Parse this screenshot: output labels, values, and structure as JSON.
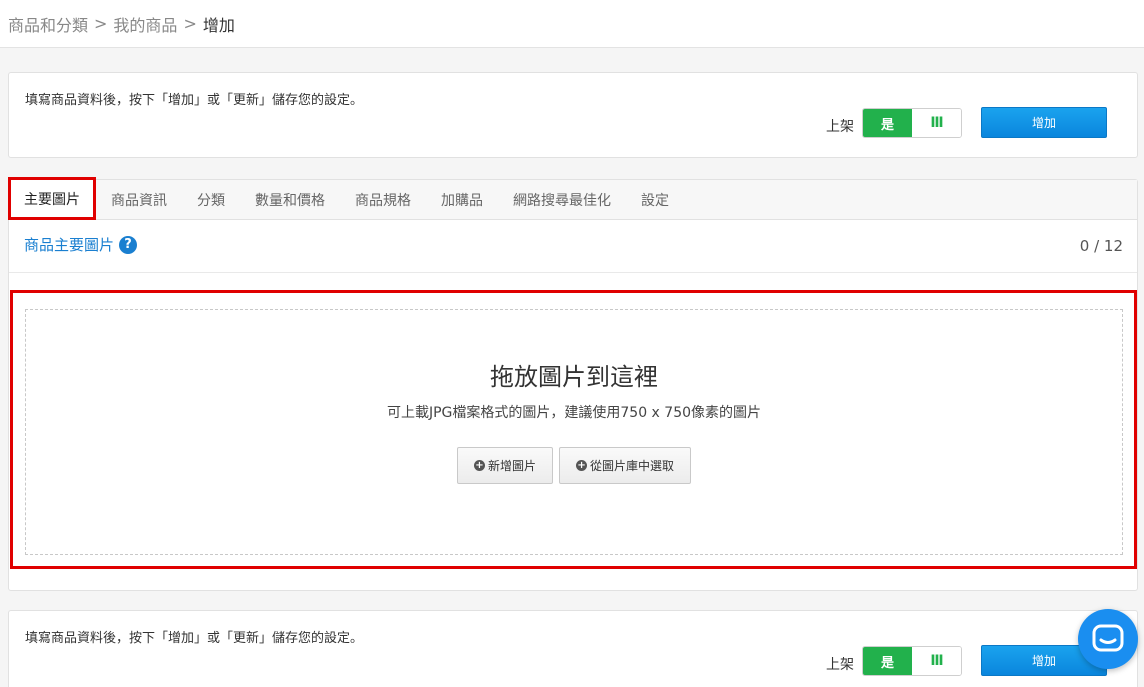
{
  "breadcrumb": {
    "items": [
      "商品和分類",
      "我的商品"
    ],
    "separator": ">",
    "current": "增加"
  },
  "save_bar": {
    "hint": "填寫商品資料後，按下「增加」或「更新」儲存您的設定。",
    "listed_label": "上架",
    "toggle_on": "是",
    "toggle_off": "Ⅲ",
    "add_button": "增加"
  },
  "tabs": [
    {
      "label": "主要圖片",
      "active": true
    },
    {
      "label": "商品資訊"
    },
    {
      "label": "分類"
    },
    {
      "label": "數量和價格"
    },
    {
      "label": "商品規格"
    },
    {
      "label": "加購品"
    },
    {
      "label": "網路搜尋最佳化"
    },
    {
      "label": "設定"
    }
  ],
  "section": {
    "title": "商品主要圖片",
    "help_icon": "question-circle-icon",
    "counter": "0 / 12"
  },
  "dropzone": {
    "title": "拖放圖片到這裡",
    "description": "可上載JPG檔案格式的圖片，建議使用750 x 750像素的圖片",
    "add_image_button": "新增圖片",
    "from_library_button": "從圖片庫中選取",
    "button_icon": "plus-circle-icon"
  },
  "chat_widget": {
    "icon": "chat-bubble-icon"
  },
  "colors": {
    "accent_blue": "#1a7fd0",
    "button_blue": "#0a86dd",
    "toggle_green": "#22b14c",
    "highlight_red": "#e00000"
  }
}
